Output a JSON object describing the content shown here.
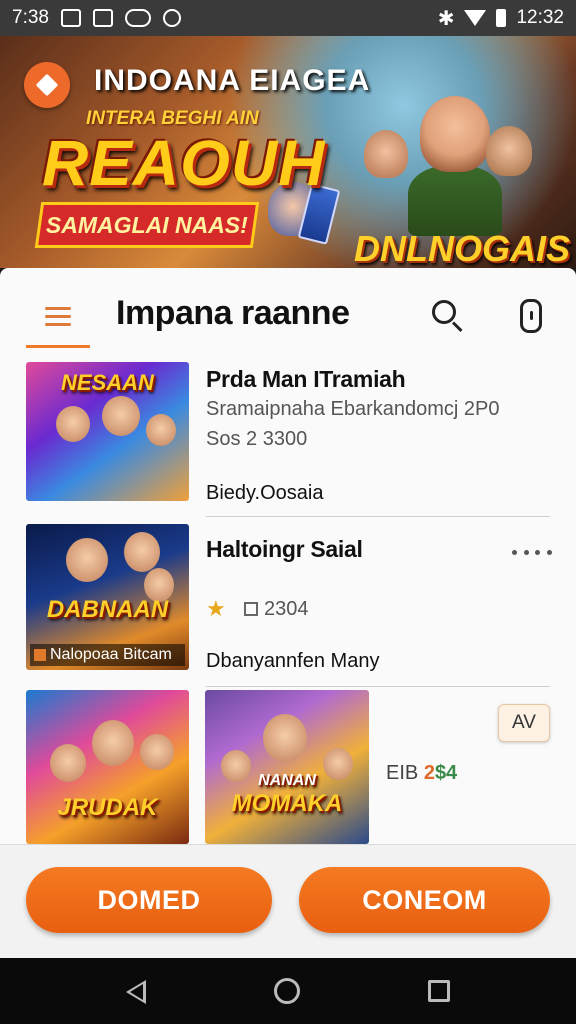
{
  "status_bar": {
    "time_left": "7:38",
    "time_right": "12:32",
    "icons": [
      "image-icon",
      "photo-icon",
      "message-icon",
      "alarm-icon",
      "bluetooth-icon",
      "wifi-icon",
      "battery-icon"
    ]
  },
  "banner": {
    "title": "INDOANA EIAGEA",
    "tagline": "INTERA BEGHI AIN",
    "headline": "REAOUH",
    "ribbon": "SAMAGLAI NAAS!",
    "subheadline": "DNLNOGAIS"
  },
  "app_bar": {
    "title": "Impana raanne",
    "menu_icon": "hamburger-icon",
    "search_icon": "search-icon",
    "device_icon": "phone-icon"
  },
  "list": {
    "items": [
      {
        "thumb_title": "NESAAN",
        "title": "Prda Man ITramiah",
        "subtitle": "Sramaipnaha Ebarkandomcj 2P0",
        "price": "Sos  2  3300",
        "footer": "Biedy.Oosaia"
      },
      {
        "thumb_title": "DABNAAN",
        "thumb_caption": "Nalopoaa Bitcam",
        "title": "Haltoingr Saial",
        "rating_value": "2304",
        "footer": "Dbanyannfen Many"
      },
      {
        "thumb_title_left": "JRUDAK",
        "thumb_title_right": "MOMAKA",
        "thumb_title_right_top": "NANAN",
        "button_label": "AV",
        "price_prefix": "EIB",
        "price_value": "2",
        "price_value2": "$4"
      }
    ]
  },
  "actions": {
    "left_label": "DOMED",
    "right_label": "CONEOM"
  },
  "colors": {
    "accent": "#ef6c1e",
    "status_bar": "#3a3a3a",
    "nav_bar": "#0a0a0a",
    "star": "#e6a81a"
  }
}
